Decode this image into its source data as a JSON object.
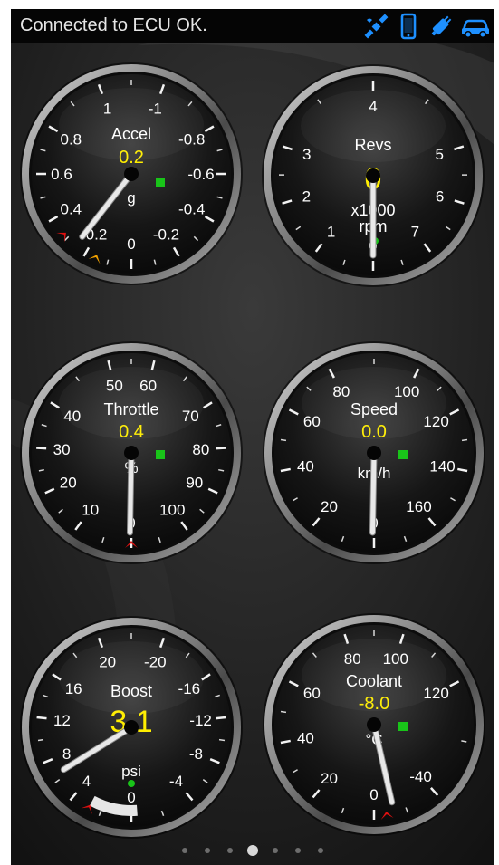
{
  "status_bar": {
    "text": "Connected to ECU OK.",
    "icons": [
      "satellite-icon",
      "phone-icon",
      "obd-adapter-icon",
      "car-icon"
    ],
    "icon_color": "#1e90ff"
  },
  "colors": {
    "value": "#ffee00",
    "label": "#ffffff",
    "indicator_green": "#19c419",
    "needle": "#e8e8e8",
    "max_marker": "#e01010",
    "min_marker": "#f0a000"
  },
  "gauges": [
    {
      "id": "accel",
      "title": "Accel",
      "value": "0.2",
      "unit": "g",
      "tick_labels": [
        "0.2",
        "0.4",
        "0.6",
        "0.8",
        "1",
        "-1",
        "-0.8",
        "-0.6",
        "-0.4",
        "-0.2",
        "0"
      ],
      "needle_value": 0.2
    },
    {
      "id": "revs",
      "title": "Revs",
      "value": "0",
      "unit": "x1000\nrpm",
      "unit_line1": "x1000",
      "unit_line2": "rpm",
      "tick_labels": [
        "0",
        "1",
        "2",
        "3",
        "4",
        "5",
        "6",
        "7"
      ],
      "needle_value": 0
    },
    {
      "id": "throttle",
      "title": "Throttle",
      "value": "0.4",
      "unit": "%",
      "tick_labels": [
        "0",
        "10",
        "20",
        "30",
        "40",
        "50",
        "60",
        "70",
        "80",
        "90",
        "100"
      ],
      "needle_value": 0.4
    },
    {
      "id": "speed",
      "title": "Speed",
      "value": "0.0",
      "unit": "km/h",
      "tick_labels": [
        "0",
        "20",
        "40",
        "60",
        "80",
        "100",
        "120",
        "140",
        "160"
      ],
      "needle_value": 0
    },
    {
      "id": "boost",
      "title": "Boost",
      "value": "3.1",
      "unit": "psi",
      "tick_labels": [
        "4",
        "8",
        "12",
        "16",
        "20",
        "-20",
        "-16",
        "-12",
        "-8",
        "-4",
        "0"
      ],
      "needle_value": 3.1
    },
    {
      "id": "coolant",
      "title": "Coolant",
      "value": "-8.0",
      "unit": "°C",
      "tick_labels": [
        "0",
        "20",
        "40",
        "60",
        "80",
        "100",
        "120",
        "-40"
      ],
      "needle_value": -8.0
    }
  ],
  "pager": {
    "pages": 7,
    "active": 4
  }
}
